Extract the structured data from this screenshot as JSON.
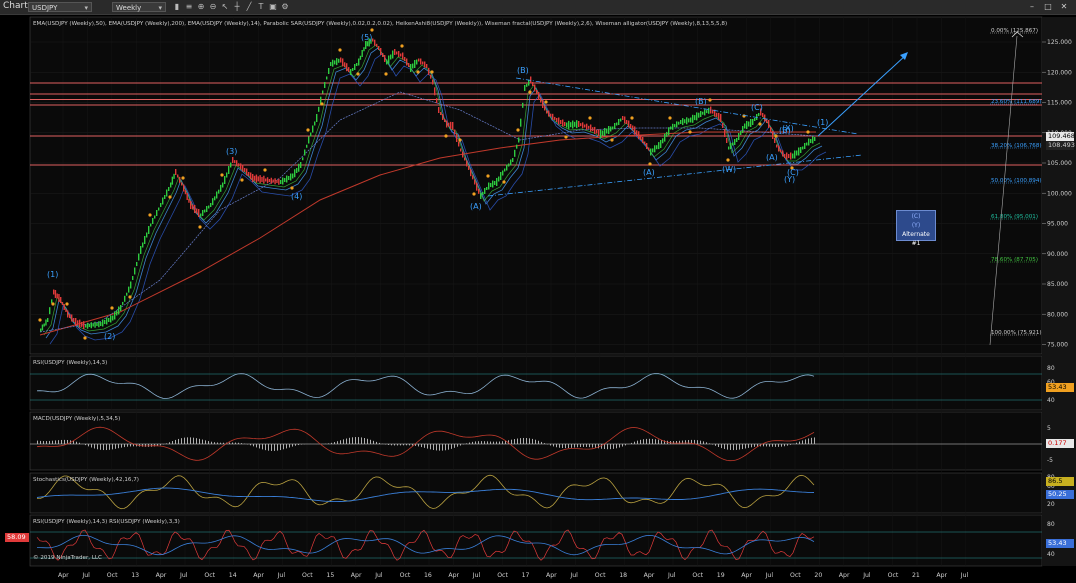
{
  "toolbar": {
    "title": "Chart",
    "instrument": "USDJPY",
    "period": "Weekly"
  },
  "panels": {
    "price_indicators": "EMA(USDJPY (Weekly),50), EMA(USDJPY (Weekly),200), EMA(USDJPY (Weekly),14), Parabolic SAR(USDJPY (Weekly),0.02,0.2,0.02), HeikenAshi8(USDJPY (Weekly)), Wiseman fractal(USDJPY (Weekly),2,6), Wiseman alligator(USDJPY (Weekly),8,13,5,5,8)",
    "rsi": "RSI(USDJPY (Weekly),14,3)",
    "macd": "MACD(USDJPY (Weekly),5,34,5)",
    "stoch": "Stochastics(USDJPY (Weekly),42,16,7)",
    "rsi2": "RSI(USDJPY (Weekly),14,3)  RSI(USDJPY (Weekly),3,3)",
    "copyright": "© 2019 NinjaTrader, LLC"
  },
  "price_axis": [
    "125.000",
    "120.000",
    "115.000",
    "110.000",
    "105.000",
    "100.000",
    "95.000",
    "90.000",
    "85.000",
    "80.000",
    "75.000"
  ],
  "price_tags": {
    "last": "109.468",
    "second": "108.493"
  },
  "fib_levels": [
    {
      "label": "0.00% (125.867)",
      "color": "#cfcfcf"
    },
    {
      "label": "23.60% (111.689)",
      "color": "#3aa0ff"
    },
    {
      "label": "38.20% (106.768)",
      "color": "#3aa0ff"
    },
    {
      "label": "50.00% (100.894)",
      "color": "#3aa0ff"
    },
    {
      "label": "61.80% (95.001)",
      "color": "#20c0a0"
    },
    {
      "label": "78.60% (87.705)",
      "color": "#40c040"
    },
    {
      "label": "100.00% (75.921)",
      "color": "#cfcfcf"
    }
  ],
  "waves": [
    "(1)",
    "(2)",
    "(3)",
    "(4)",
    "(5)",
    "(B)",
    "(A)",
    "(A)",
    "(B)",
    "(C)",
    "(X)",
    "(W)",
    "(A)",
    "(B)",
    "(C)",
    "(Y)",
    "(1)"
  ],
  "alternate": {
    "line1": "(C)",
    "line2": "(Y)",
    "name": "Alternate #1"
  },
  "rsi_axis": [
    "80",
    "60",
    "40"
  ],
  "rsi_value": "53.43",
  "macd_axis": [
    "5",
    "0",
    "-5"
  ],
  "macd_value": "0.177",
  "stoch_axis": [
    "80",
    "60",
    "40",
    "20"
  ],
  "stoch_values": [
    "86.5",
    "50.25"
  ],
  "rsi2_axis": [
    "80",
    "60",
    "40"
  ],
  "rsi2_values": [
    "53.43"
  ],
  "rsi2_left_tag": "58.09",
  "time_axis": [
    "Apr",
    "Jul",
    "Oct",
    "13",
    "Apr",
    "Jul",
    "Oct",
    "14",
    "Apr",
    "Jul",
    "Oct",
    "15",
    "Apr",
    "Jul",
    "Oct",
    "16",
    "Apr",
    "Jul",
    "Oct",
    "17",
    "Apr",
    "Jul",
    "Oct",
    "18",
    "Apr",
    "Jul",
    "Oct",
    "19",
    "Apr",
    "Jul",
    "Oct",
    "20",
    "Apr",
    "Jul",
    "Oct",
    "21",
    "Apr",
    "Jul"
  ],
  "colors": {
    "accent": "#3aa0ff",
    "bull": "#2ecc40",
    "bear": "#e03a3a",
    "sar": "#f0a020",
    "hline": "#e06060"
  }
}
